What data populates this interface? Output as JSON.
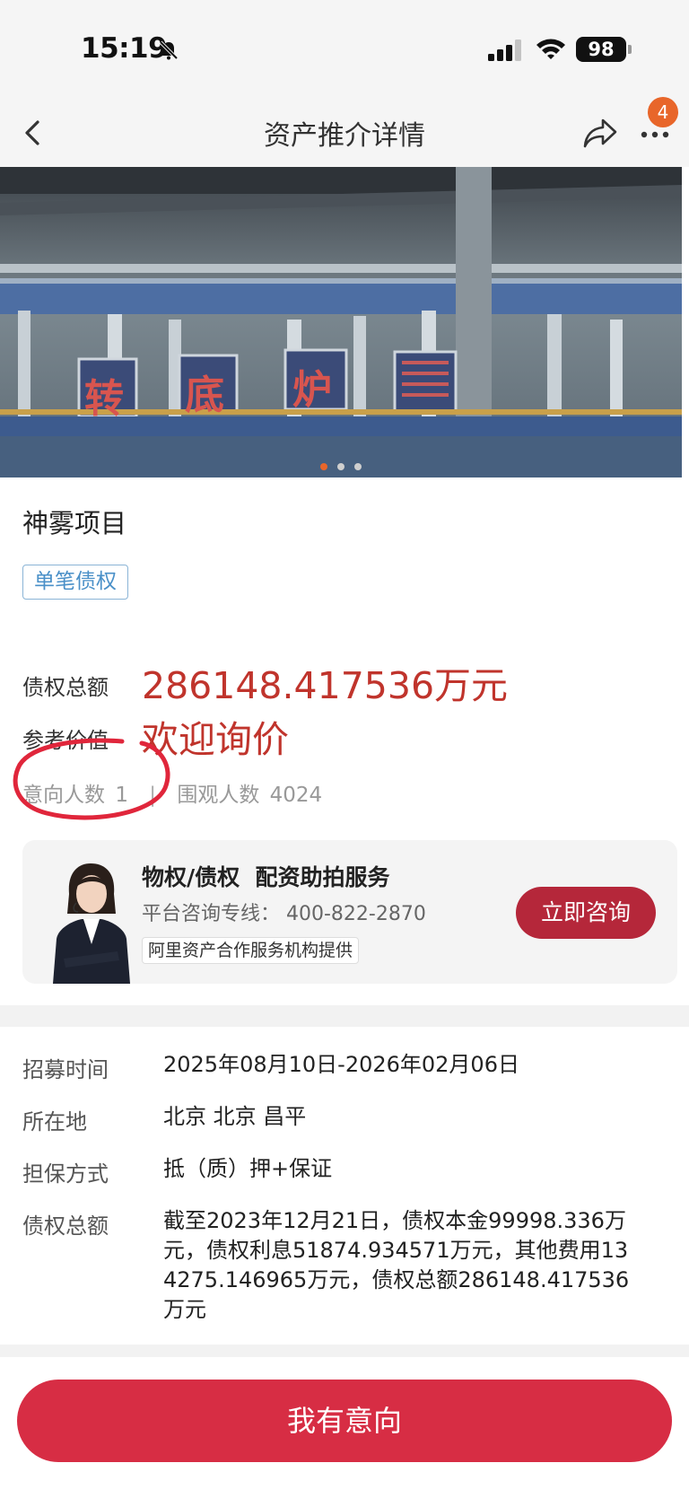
{
  "status_bar": {
    "time": "15:19",
    "battery": "98"
  },
  "nav": {
    "title": "资产推介详情",
    "badge_count": "4"
  },
  "hero": {
    "sign_chars": [
      "转",
      "底",
      "炉"
    ],
    "carousel": {
      "total": 3,
      "active": 1
    }
  },
  "project": {
    "title": "神雾项目",
    "tag": "单笔债权",
    "total_label": "债权总额",
    "total_value": "286148.417536万元",
    "ref_label": "参考价值",
    "ref_value": "欢迎询价",
    "intent_label": "意向人数",
    "intent_count": "1",
    "view_label": "围观人数",
    "view_count": "4024"
  },
  "service": {
    "title": "物权/债权  配资助拍服务",
    "phone": "平台咨询专线： 400-822-2870",
    "provider": "阿里资产合作服务机构提供",
    "button": "立即咨询"
  },
  "details": [
    {
      "label": "招募时间",
      "value": "2025年08月10日-2026年02月06日"
    },
    {
      "label": "所在地",
      "value": "北京 北京 昌平"
    },
    {
      "label": "担保方式",
      "value": "抵（质）押+保证"
    },
    {
      "label": "债权总额",
      "value": "截至2023年12月21日，债权本金99998.336万元，债权利息51874.934571万元，其他费用134275.146965万元，债权总额286148.417536万元"
    }
  ],
  "bottom": {
    "intent_button": "我有意向"
  },
  "colors": {
    "accent_red": "#c0342c",
    "button_red": "#d72d44",
    "badge_orange": "#e8662a",
    "tag_blue": "#4a90c8"
  }
}
